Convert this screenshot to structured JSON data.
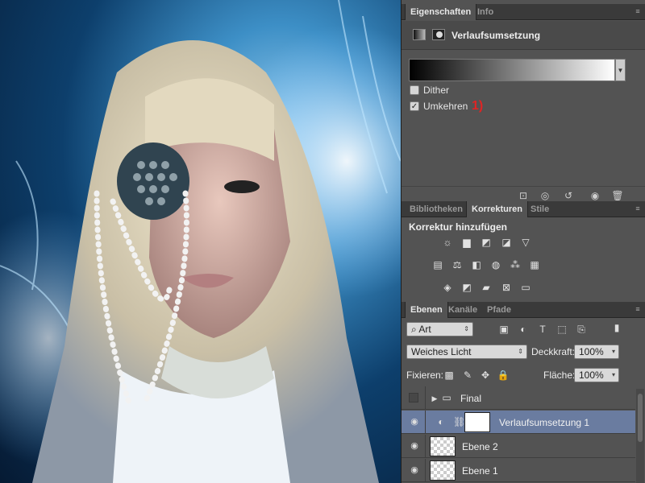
{
  "properties": {
    "tabs": [
      {
        "label": "Eigenschaften"
      },
      {
        "label": "Info"
      }
    ],
    "header_title": "Verlaufsumsetzung",
    "dither_label": "Dither",
    "dither_checked": false,
    "reverse_label": "Umkehren",
    "reverse_checked": true,
    "annotation": "1)"
  },
  "corrections": {
    "tabs": [
      {
        "label": "Bibliotheken"
      },
      {
        "label": "Korrekturen"
      },
      {
        "label": "Stile"
      }
    ],
    "title": "Korrektur hinzufügen"
  },
  "layers": {
    "tabs": [
      {
        "label": "Ebenen"
      },
      {
        "label": "Kanäle"
      },
      {
        "label": "Pfade"
      }
    ],
    "filter_kind": "Art",
    "blend_mode": "Weiches Licht",
    "opacity_label": "Deckkraft:",
    "opacity_value": "100%",
    "lock_label": "Fixieren:",
    "fill_label": "Fläche:",
    "fill_value": "100%",
    "items": [
      {
        "name": "Final",
        "type": "group",
        "visible": false
      },
      {
        "name": "Verlaufsumsetzung 1",
        "type": "adjustment",
        "visible": true,
        "selected": true
      },
      {
        "name": "Ebene 2",
        "type": "layer",
        "visible": true
      },
      {
        "name": "Ebene 1",
        "type": "layer",
        "visible": true
      }
    ]
  },
  "colors": {
    "panel": "#535353",
    "selection": "#6a7ca0",
    "annotation": "#e02424"
  }
}
